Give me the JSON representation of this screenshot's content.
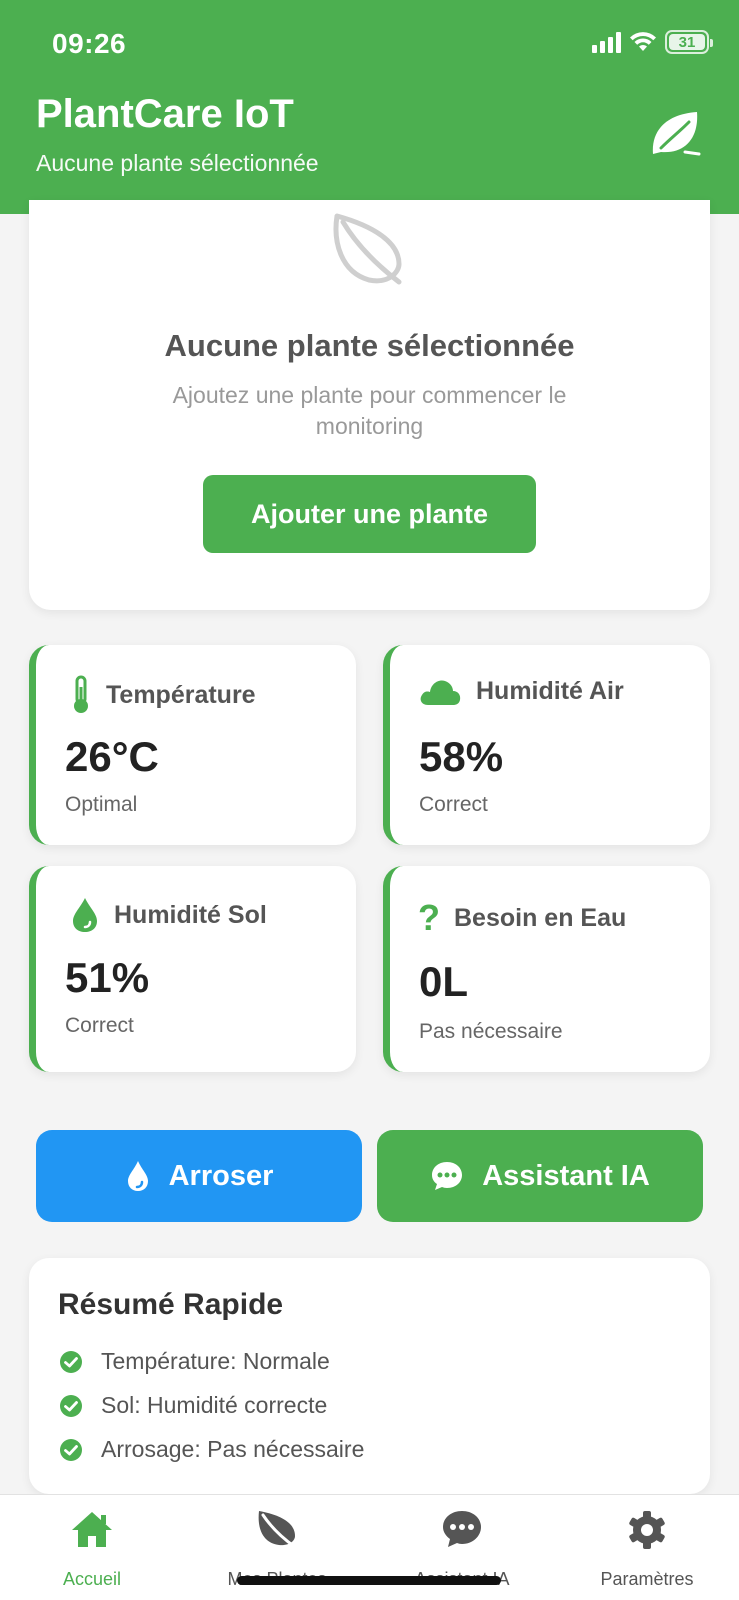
{
  "status_bar": {
    "time": "09:26",
    "battery": "31"
  },
  "header": {
    "title": "PlantCare IoT",
    "subtitle": "Aucune plante sélectionnée"
  },
  "empty_state": {
    "title": "Aucune plante sélectionnée",
    "description": "Ajoutez une plante pour commencer le monitoring",
    "button_label": "Ajouter une plante"
  },
  "metrics": [
    {
      "label": "Température",
      "value": "26°C",
      "status": "Optimal",
      "icon": "thermometer-icon"
    },
    {
      "label": "Humidité Air",
      "value": "58%",
      "status": "Correct",
      "icon": "cloud-icon"
    },
    {
      "label": "Humidité Sol",
      "value": "51%",
      "status": "Correct",
      "icon": "water-drop-icon"
    },
    {
      "label": "Besoin en Eau",
      "value": "0L",
      "status": "Pas nécessaire",
      "icon": "question-icon"
    }
  ],
  "actions": {
    "water_label": "Arroser",
    "assistant_label": "Assistant IA"
  },
  "summary": {
    "title": "Résumé Rapide",
    "items": [
      "Température: Normale",
      "Sol: Humidité correcte",
      "Arrosage: Pas nécessaire"
    ]
  },
  "tabs": [
    {
      "label": "Accueil",
      "icon": "home-icon",
      "active": true
    },
    {
      "label": "Mes Plantes",
      "icon": "leaf-icon",
      "active": false
    },
    {
      "label": "Assistant IA",
      "icon": "chat-icon",
      "active": false
    },
    {
      "label": "Paramètres",
      "icon": "gear-icon",
      "active": false
    }
  ],
  "colors": {
    "primary": "#4caf50",
    "water_button": "#2196f3",
    "background": "#f4f4f4"
  }
}
